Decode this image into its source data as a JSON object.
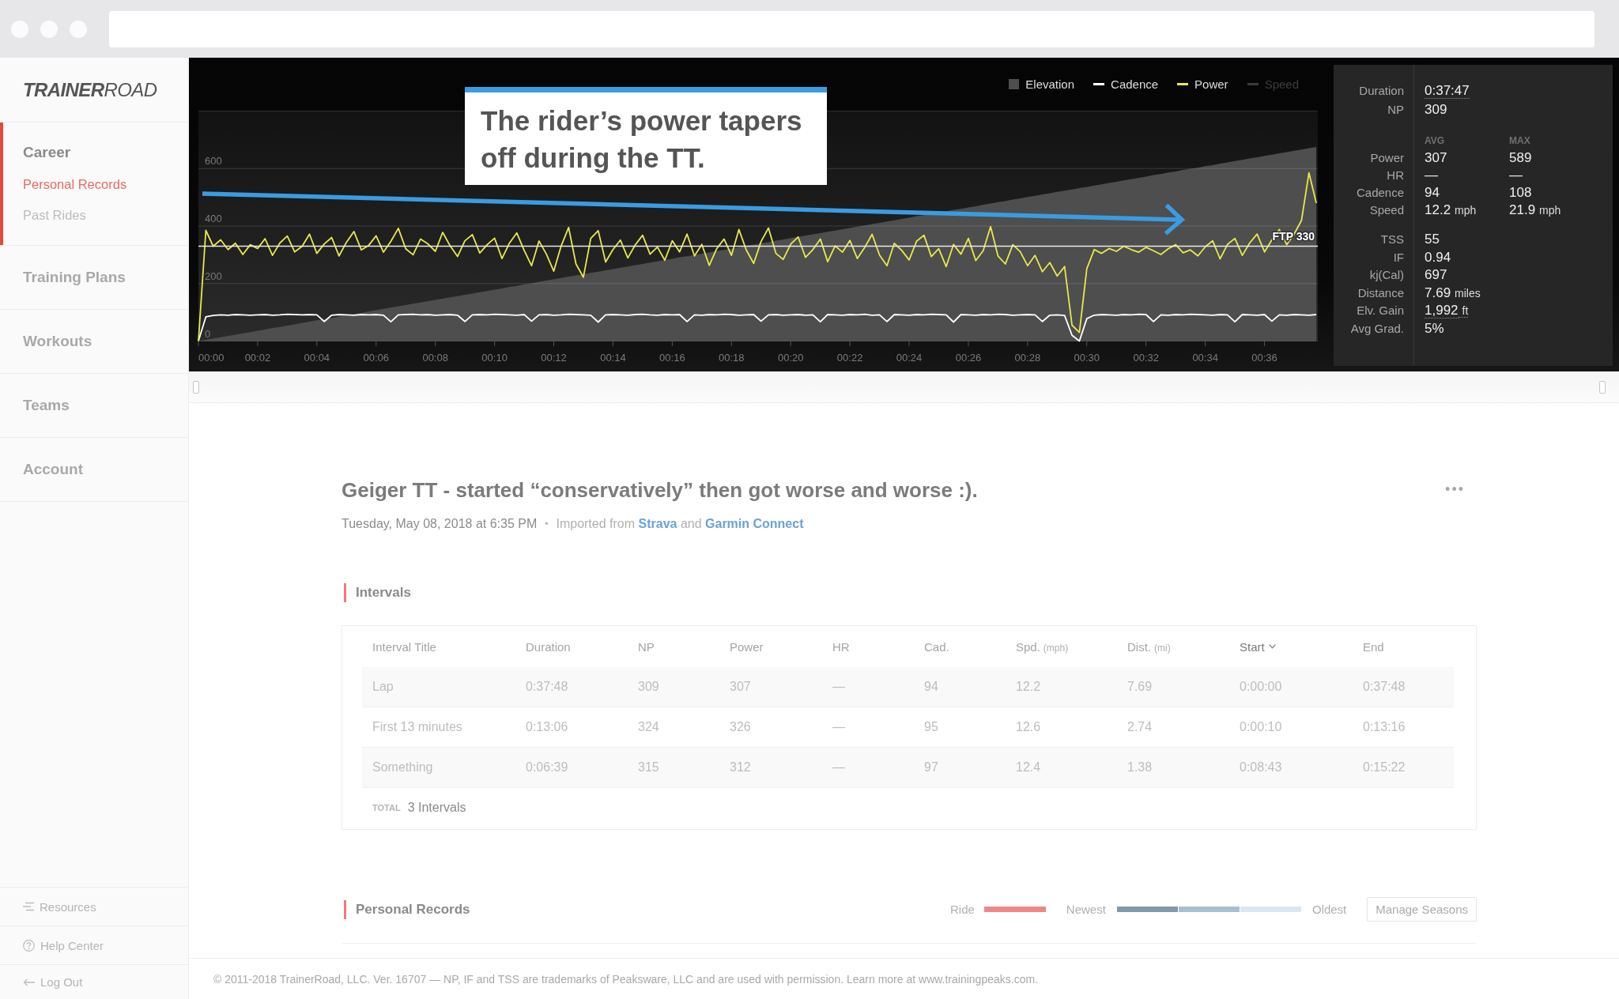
{
  "sidebar": {
    "logo": "**TRAINER**ROAD",
    "nav": [
      {
        "label": "Career",
        "selected": true,
        "children": [
          {
            "label": "Personal Records",
            "selected": true
          },
          {
            "label": "Past Rides",
            "selected": false
          }
        ]
      },
      {
        "label": "Training Plans",
        "selected": false
      },
      {
        "label": "Workouts",
        "selected": false
      },
      {
        "label": "Teams",
        "selected": false
      },
      {
        "label": "Account",
        "selected": false
      }
    ],
    "footer_links": [
      {
        "label": "Resources",
        "kind": "resources"
      },
      {
        "label": "Help Center",
        "kind": "help"
      },
      {
        "label": "Log Out",
        "kind": "logout"
      }
    ]
  },
  "chart": {
    "chart_data": {
      "type": "line",
      "x": [
        0,
        0.25,
        0.5,
        0.75,
        1,
        1.25,
        1.5,
        1.75,
        2,
        2.25,
        2.5,
        2.75,
        3,
        3.25,
        3.5,
        3.75,
        4,
        4.25,
        4.5,
        4.75,
        5,
        5.25,
        5.5,
        5.75,
        6,
        6.25,
        6.5,
        6.75,
        7,
        7.25,
        7.5,
        7.75,
        8,
        8.25,
        8.5,
        8.75,
        9,
        9.25,
        9.5,
        9.75,
        10,
        10.25,
        10.5,
        10.75,
        11,
        11.25,
        11.5,
        11.75,
        12,
        12.25,
        12.5,
        12.75,
        13,
        13.25,
        13.5,
        13.75,
        14,
        14.25,
        14.5,
        14.75,
        15,
        15.25,
        15.5,
        15.75,
        16,
        16.25,
        16.5,
        16.75,
        17,
        17.25,
        17.5,
        17.75,
        18,
        18.25,
        18.5,
        18.75,
        19,
        19.25,
        19.5,
        19.75,
        20,
        20.25,
        20.5,
        20.75,
        21,
        21.25,
        21.5,
        21.75,
        22,
        22.25,
        22.5,
        22.75,
        23,
        23.25,
        23.5,
        23.75,
        24,
        24.25,
        24.5,
        24.75,
        25,
        25.25,
        25.5,
        25.75,
        26,
        26.25,
        26.5,
        26.75,
        27,
        27.25,
        27.5,
        27.75,
        28,
        28.25,
        28.5,
        28.75,
        29,
        29.25,
        29.5,
        29.75,
        30,
        30.25,
        30.5,
        30.75,
        31,
        31.25,
        31.5,
        31.75,
        32,
        32.25,
        32.5,
        32.75,
        33,
        33.25,
        33.5,
        33.75,
        34,
        34.25,
        34.5,
        34.75,
        35,
        35.25,
        35.5,
        35.75,
        36,
        36.25,
        36.5,
        36.75,
        37,
        37.25,
        37.5,
        37.75
      ],
      "xlim": [
        0,
        37.8
      ],
      "ylim": [
        0,
        800
      ],
      "grid": true,
      "xticks": [
        {
          "value": 0,
          "label": "00:00"
        },
        {
          "value": 2,
          "label": "00:02"
        },
        {
          "value": 4,
          "label": "00:04"
        },
        {
          "value": 6,
          "label": "00:06"
        },
        {
          "value": 8,
          "label": "00:08"
        },
        {
          "value": 10,
          "label": "00:10"
        },
        {
          "value": 12,
          "label": "00:12"
        },
        {
          "value": 14,
          "label": "00:14"
        },
        {
          "value": 16,
          "label": "00:16"
        },
        {
          "value": 18,
          "label": "00:18"
        },
        {
          "value": 20,
          "label": "00:20"
        },
        {
          "value": 22,
          "label": "00:22"
        },
        {
          "value": 24,
          "label": "00:24"
        },
        {
          "value": 26,
          "label": "00:26"
        },
        {
          "value": 28,
          "label": "00:28"
        },
        {
          "value": 30,
          "label": "00:30"
        },
        {
          "value": 32,
          "label": "00:32"
        },
        {
          "value": 34,
          "label": "00:34"
        },
        {
          "value": 36,
          "label": "00:36"
        }
      ],
      "yticks": [
        600,
        400,
        200,
        0
      ],
      "series": [
        {
          "name": "Elevation",
          "color": "#4e4e4e",
          "type": "area",
          "values": [
            0,
            4,
            9,
            13,
            18,
            22,
            27,
            31,
            36,
            40,
            45,
            49,
            54,
            58,
            63,
            67,
            72,
            76,
            80,
            85,
            89,
            94,
            98,
            103,
            107,
            112,
            116,
            121,
            125,
            130,
            134,
            139,
            143,
            148,
            152,
            156,
            161,
            165,
            170,
            174,
            179,
            183,
            188,
            192,
            197,
            201,
            206,
            210,
            215,
            219,
            224,
            228,
            232,
            237,
            241,
            246,
            250,
            255,
            259,
            264,
            268,
            273,
            277,
            282,
            286,
            291,
            295,
            299,
            304,
            308,
            313,
            317,
            322,
            326,
            331,
            335,
            340,
            344,
            349,
            353,
            358,
            362,
            367,
            371,
            375,
            380,
            384,
            389,
            393,
            398,
            402,
            407,
            411,
            416,
            420,
            425,
            429,
            434,
            438,
            443,
            447,
            451,
            456,
            460,
            465,
            469,
            474,
            478,
            483,
            487,
            492,
            496,
            501,
            505,
            510,
            514,
            519,
            523,
            527,
            532,
            536,
            541,
            545,
            550,
            554,
            559,
            563,
            568,
            572,
            577,
            581,
            586,
            590,
            595,
            599,
            603,
            608,
            612,
            617,
            621,
            626,
            630,
            635,
            639,
            644,
            648,
            653,
            657,
            662,
            666,
            671,
            675
          ]
        },
        {
          "name": "Cadence",
          "color": "#ffffff",
          "values": [
            0,
            84,
            89,
            91,
            90,
            92,
            91,
            90,
            91,
            92,
            90,
            91,
            93,
            92,
            91,
            92,
            91,
            68,
            90,
            92,
            91,
            90,
            92,
            91,
            92,
            90,
            67,
            91,
            92,
            93,
            91,
            92,
            90,
            91,
            92,
            90,
            68,
            91,
            92,
            91,
            93,
            92,
            91,
            90,
            92,
            69,
            91,
            92,
            90,
            91,
            93,
            92,
            91,
            90,
            66,
            91,
            92,
            91,
            90,
            92,
            93,
            91,
            90,
            92,
            91,
            92,
            68,
            91,
            90,
            92,
            91,
            93,
            92,
            90,
            91,
            92,
            69,
            91,
            92,
            90,
            91,
            92,
            90,
            91,
            67,
            92,
            91,
            90,
            92,
            91,
            93,
            90,
            91,
            68,
            92,
            91,
            90,
            92,
            91,
            93,
            92,
            91,
            66,
            92,
            91,
            90,
            92,
            91,
            93,
            92,
            90,
            91,
            92,
            91,
            68,
            90,
            91,
            89,
            20,
            0,
            78,
            90,
            92,
            91,
            90,
            92,
            91,
            93,
            92,
            68,
            91,
            90,
            92,
            91,
            93,
            92,
            91,
            90,
            92,
            91,
            67,
            92,
            91,
            90,
            92,
            69,
            91,
            90,
            92,
            91,
            90,
            92
          ]
        },
        {
          "name": "Power",
          "color": "#e9e84c",
          "values": [
            0,
            385,
            330,
            352,
            318,
            340,
            301,
            335,
            322,
            356,
            298,
            341,
            365,
            310,
            329,
            372,
            305,
            338,
            360,
            296,
            344,
            381,
            317,
            333,
            366,
            309,
            347,
            392,
            321,
            300,
            355,
            338,
            312,
            378,
            331,
            294,
            349,
            370,
            306,
            335,
            358,
            287,
            340,
            376,
            315,
            262,
            348,
            302,
            243,
            331,
            395,
            268,
            222,
            357,
            384,
            275,
            318,
            351,
            289,
            334,
            368,
            302,
            327,
            281,
            349,
            310,
            372,
            296,
            336,
            263,
            321,
            355,
            298,
            388,
            317,
            270,
            346,
            393,
            305,
            284,
            337,
            362,
            291,
            318,
            355,
            276,
            331,
            309,
            350,
            287,
            326,
            371,
            299,
            262,
            340,
            315,
            282,
            347,
            368,
            294,
            321,
            259,
            336,
            302,
            357,
            280,
            314,
            398,
            296,
            268,
            335,
            311,
            262,
            298,
            241,
            273,
            226,
            259,
            55,
            30,
            252,
            318,
            305,
            322,
            312,
            330,
            318,
            309,
            326,
            314,
            301,
            321,
            335,
            307,
            317,
            296,
            328,
            349,
            286,
            336,
            357,
            298,
            341,
            372,
            310,
            352,
            388,
            335,
            372,
            420,
            585,
            480
          ]
        }
      ],
      "ref_lines": [
        {
          "axis": "y",
          "value": 330,
          "label": "FTP 330"
        }
      ],
      "annotations": [
        "The rider’s power tapers off during the TT."
      ]
    },
    "hidden_series": [
      {
        "name": "Speed",
        "color": "#3a3a3a",
        "on": false
      }
    ]
  },
  "stats": {
    "summary": [
      {
        "label": "Duration",
        "value": "0:37:47",
        "dotted": true
      },
      {
        "label": "NP",
        "value": "309",
        "dotted": false
      }
    ],
    "columns": [
      "AVG",
      "MAX"
    ],
    "metrics": [
      {
        "label": "Power",
        "avg": {
          "value": "307"
        },
        "max": {
          "value": "589"
        }
      },
      {
        "label": "HR",
        "avg": {
          "value": "—"
        },
        "max": {
          "value": "—"
        }
      },
      {
        "label": "Cadence",
        "avg": {
          "value": "94"
        },
        "max": {
          "value": "108"
        }
      },
      {
        "label": "Speed",
        "avg": {
          "value": "12.2",
          "unit": "mph"
        },
        "max": {
          "value": "21.9",
          "unit": "mph"
        }
      }
    ],
    "totals": [
      {
        "label": "TSS",
        "value": "55",
        "dotted": false
      },
      {
        "label": "IF",
        "value": "0.94",
        "dotted": false
      },
      {
        "label": "kj(Cal)",
        "value": "697",
        "dotted": false
      },
      {
        "label": "Distance",
        "value": "7.69",
        "unit": "miles",
        "dotted": false
      },
      {
        "label": "Elv. Gain",
        "value": "1,992",
        "unit": "ft",
        "dotted": true
      },
      {
        "label": "Avg Grad.",
        "value": "5%",
        "dotted": false
      }
    ]
  },
  "activity": {
    "title": "Geiger TT - started “conservatively” then got worse and worse :).",
    "date": "Tuesday, May 08, 2018 at 6:35 PM",
    "separator": "•",
    "import_note": [
      {
        "kind": "text",
        "text": "Imported from"
      },
      {
        "kind": "link",
        "text": "Strava"
      },
      {
        "kind": "text",
        "text": "and"
      },
      {
        "kind": "link",
        "text": "Garmin Connect"
      }
    ],
    "menu": "•••"
  },
  "intervals": {
    "heading": "Intervals",
    "columns": [
      {
        "label": "Interval Title",
        "sorted": false
      },
      {
        "label": "Duration",
        "sorted": false
      },
      {
        "label": "NP",
        "sorted": false
      },
      {
        "label": "Power",
        "sorted": false
      },
      {
        "label": "HR",
        "sorted": false
      },
      {
        "label": "Cad.",
        "sorted": false
      },
      {
        "label": "Spd.",
        "unit": "(mph)",
        "sorted": false
      },
      {
        "label": "Dist.",
        "unit": "(mi)",
        "sorted": false
      },
      {
        "label": "Start",
        "sorted": true
      },
      {
        "label": "End",
        "sorted": false
      }
    ],
    "rows": [
      [
        "Lap",
        "0:37:48",
        "309",
        "307",
        "—",
        "94",
        "12.2",
        "7.69",
        "0:00:00",
        "0:37:48"
      ],
      [
        "First 13 minutes",
        "0:13:06",
        "324",
        "326",
        "—",
        "95",
        "12.6",
        "2.74",
        "0:00:10",
        "0:13:16"
      ],
      [
        "Something",
        "0:06:39",
        "315",
        "312",
        "—",
        "97",
        "12.4",
        "1.38",
        "0:08:43",
        "0:15:22"
      ]
    ],
    "total": {
      "label": "TOTAL",
      "value": "3 Intervals"
    }
  },
  "personal_records": {
    "heading": "Personal Records",
    "ride": {
      "label": "Ride",
      "color": "#ef8787"
    },
    "seasons": {
      "start_label": "Newest",
      "end_label": "Oldest",
      "swatches": [
        {
          "color": "#8499ab"
        },
        {
          "color": "#a8bfd2"
        },
        {
          "color": "#dbe7f0"
        }
      ]
    },
    "button": "Manage Seasons"
  },
  "footer": {
    "text": "© 2011-2018 TrainerRoad, LLC. Ver. 16707 — NP, IF and TSS are trademarks of Peaksware, LLC and are used with permission. Learn more at www.trainingpeaks.com."
  }
}
